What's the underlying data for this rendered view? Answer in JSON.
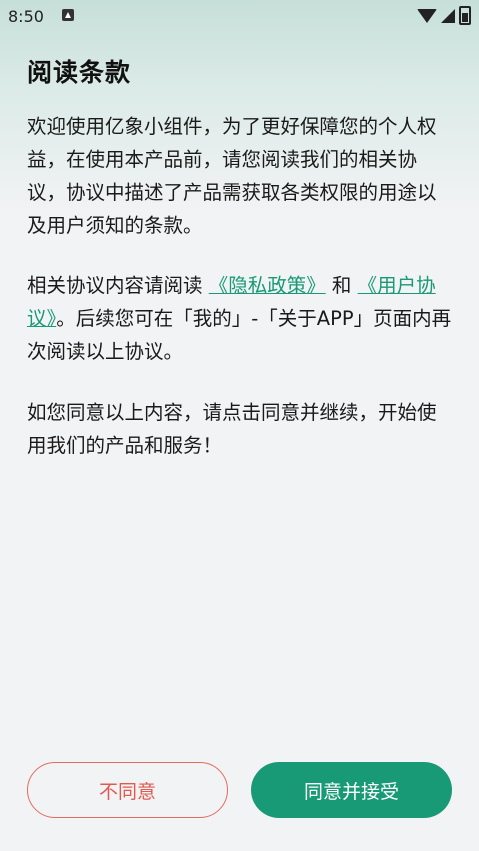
{
  "status": {
    "time": "8:50"
  },
  "title": "阅读条款",
  "paragraph1": "欢迎使用亿象小组件，为了更好保障您的个人权益，在使用本产品前，请您阅读我们的相关协议，协议中描述了产品需获取各类权限的用途以及用户须知的条款。",
  "paragraph2": {
    "prefix": "相关协议内容请阅读 ",
    "privacy_link": "《隐私政策》",
    "and": " 和 ",
    "user_link": "《用户协议》",
    "suffix": "。后续您可在「我的」-「关于APP」页面内再次阅读以上协议。"
  },
  "paragraph3": "如您同意以上内容，请点击同意并继续，开始使用我们的产品和服务！",
  "buttons": {
    "decline": "不同意",
    "accept": "同意并接受"
  },
  "colors": {
    "accent": "#199a76",
    "decline": "#e05a50"
  }
}
